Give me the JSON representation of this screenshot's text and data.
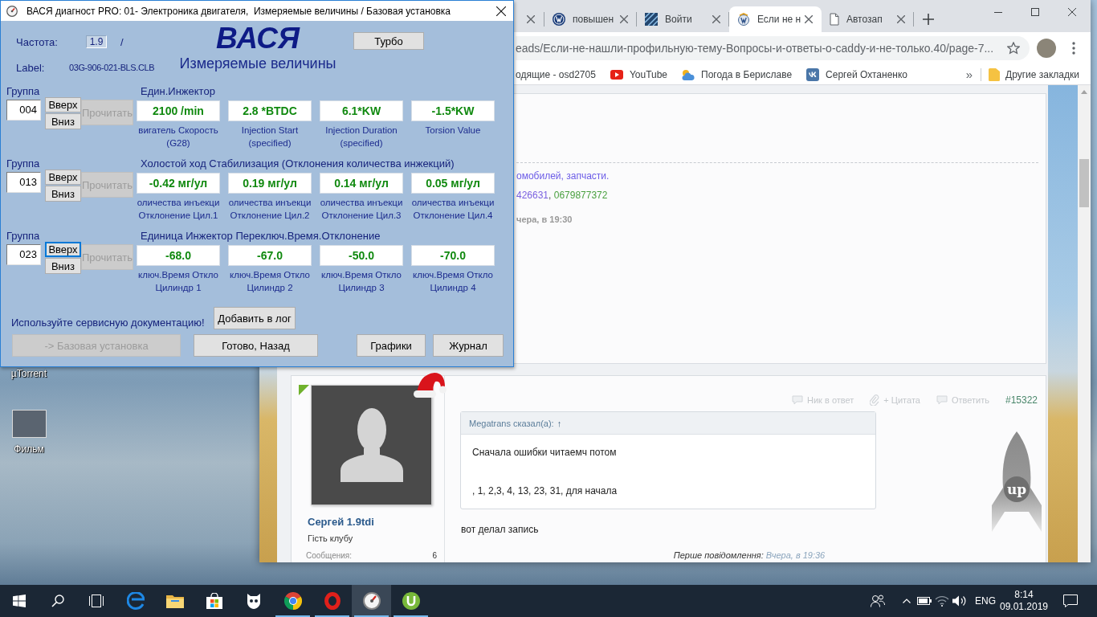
{
  "vasya_window": {
    "title": "ВАСЯ диагност PRO: 01- Электроника двигателя,  Измеряемые величины / Базовая установка",
    "frequency": {
      "label": "Частота:",
      "value": "1.9",
      "suffix": "/"
    },
    "logo": "ВАСЯ",
    "turbo_button": "Турбо",
    "label": {
      "caption": "Label:",
      "value": "03G-906-021-BLS.CLB"
    },
    "mode_title": "Измеряемые величины",
    "groups": [
      {
        "caption": "Группа",
        "number": "004",
        "up": {
          "label": "Вверх",
          "focused": false
        },
        "down": "Вниз",
        "read": {
          "label": "Прочитать",
          "disabled": true
        },
        "title": "Един.Инжектор",
        "fields": [
          {
            "value": "2100 /min",
            "caption": [
              "вигатель Скорость",
              "(G28)"
            ]
          },
          {
            "value": "2.8 *BTDC",
            "caption": [
              "Injection Start",
              "(specified)"
            ]
          },
          {
            "value": "6.1*KW",
            "caption": [
              "Injection Duration",
              "(specified)"
            ]
          },
          {
            "value": "-1.5*KW",
            "caption": [
              "Torsion Value"
            ]
          }
        ]
      },
      {
        "caption": "Группа",
        "number": "013",
        "up": {
          "label": "Вверх",
          "focused": false
        },
        "down": "Вниз",
        "read": {
          "label": "Прочитать",
          "disabled": true
        },
        "title": "Холостой ход Стабилизация (Отклонения количества инжекций)",
        "fields": [
          {
            "value": "-0.42 мг/ул",
            "caption": [
              "оличества инъекци",
              "Отклонение Цил.1"
            ]
          },
          {
            "value": "0.19 мг/ул",
            "caption": [
              "оличества инъекци",
              "Отклонение Цил.2"
            ]
          },
          {
            "value": "0.14 мг/ул",
            "caption": [
              "оличества инъекци",
              "Отклонение Цил.3"
            ]
          },
          {
            "value": "0.05 мг/ул",
            "caption": [
              "оличества инъекци",
              "Отклонение Цил.4"
            ]
          }
        ]
      },
      {
        "caption": "Группа",
        "number": "023",
        "up": {
          "label": "Вверх",
          "focused": true
        },
        "down": "Вниз",
        "read": {
          "label": "Прочитать",
          "disabled": true
        },
        "title": "Единица Инжектор Переключ.Время.Отклонение",
        "fields": [
          {
            "value": "-68.0",
            "caption": [
              "ключ.Время Откло",
              "Цилиндр 1"
            ]
          },
          {
            "value": "-67.0",
            "caption": [
              "ключ.Время Откло",
              "Цилиндр 2"
            ]
          },
          {
            "value": "-50.0",
            "caption": [
              "ключ.Время Откло",
              "Цилиндр 3"
            ]
          },
          {
            "value": "-70.0",
            "caption": [
              "ключ.Время Откло",
              "Цилиндр 4"
            ]
          }
        ]
      }
    ],
    "notice": "Используйте сервисную документацию!",
    "log_button": "Добавить в лог",
    "buttons": [
      {
        "label": "-> Базовая установка",
        "disabled": true
      },
      {
        "label": "Готово, Назад",
        "disabled": false
      },
      {
        "label": "Графики",
        "disabled": false
      },
      {
        "label": "Журнал",
        "disabled": false
      }
    ]
  },
  "desktop_icons": [
    {
      "label": "µTorrent"
    },
    {
      "label": "Фильм",
      "kind": "photo"
    }
  ],
  "browser": {
    "tabs": [
      {
        "selected": false
      },
      {
        "title": "повышен",
        "selected": false,
        "kind": "vw"
      },
      {
        "title": "Войти",
        "selected": false,
        "kind": "stripes"
      },
      {
        "title": "Если не н",
        "selected": true,
        "kind": "forum"
      },
      {
        "title": "Автозап",
        "selected": false,
        "kind": "page"
      }
    ],
    "address": "eads/Если-не-нашли-профильную-тему-Вопросы-и-ответы-о-caddy-и-не-только.40/page-7...",
    "bookmarks": [
      {
        "label": "одящие - osd2705"
      },
      {
        "label": "YouTube",
        "kind": "youtube"
      },
      {
        "label": "Погода в Бериславе",
        "kind": "weather"
      },
      {
        "label": "Сергей Охтаненко",
        "kind": "vk"
      }
    ],
    "bookmarks_more": "»",
    "other_bookmarks": "Другие закладки",
    "page": {
      "signature": {
        "text": "омобилей, запчасти.",
        "phones": [
          "426631",
          "0679877372"
        ],
        "separator": ",",
        "date": "чера, в 19:30"
      },
      "post": {
        "author": "Сергей 1.9tdi",
        "role": "Гість клубу",
        "stats": [
          {
            "label": "Сообщения:",
            "value": "6"
          }
        ],
        "actions": [
          {
            "label": "Ник в ответ",
            "kind": "bubble"
          },
          {
            "label": "+ Цитата",
            "kind": "clip"
          },
          {
            "label": "Ответить",
            "kind": "bubble"
          }
        ],
        "number": "#15322",
        "quote": {
          "author": "Megatrans сказал(а):",
          "link": "↑",
          "lines": [
            "Сначала ошибки читаемч потом",
            ", 1, 2,3, 4, 13, 23, 31, для начала"
          ]
        },
        "text": "вот делал запись",
        "first_message": {
          "label": "Перше повідомлення:",
          "date": "Вчера, в 19:36"
        }
      },
      "scroll_up": "up"
    }
  },
  "taskbar": {
    "apps": [
      {
        "kind": "edge",
        "running": false,
        "selected": false
      },
      {
        "kind": "explorer",
        "running": false,
        "selected": false
      },
      {
        "kind": "store",
        "running": false,
        "selected": false
      },
      {
        "kind": "owl",
        "running": false,
        "selected": false
      },
      {
        "kind": "chrome",
        "running": true,
        "selected": false
      },
      {
        "kind": "opera",
        "running": true,
        "selected": false
      },
      {
        "kind": "vasya",
        "running": true,
        "selected": true
      },
      {
        "kind": "utorrent",
        "running": true,
        "selected": false
      }
    ],
    "language": "ENG",
    "time": "8:14",
    "date": "09.01.2019"
  }
}
